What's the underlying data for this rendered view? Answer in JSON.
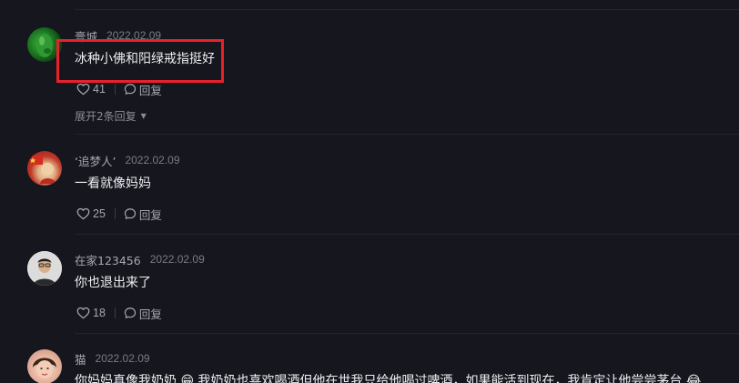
{
  "colors": {
    "background": "#15161e",
    "highlight": "#e8212b",
    "text_primary": "#eeeef0",
    "text_secondary": "#a8a9af"
  },
  "comments": [
    {
      "username": "膏城",
      "date": "2022.02.09",
      "text": "冰种小佛和阳绿戒指挺好",
      "likes": "41",
      "reply_label": "回复",
      "expand_label": "展开2条回复",
      "highlighted": true
    },
    {
      "username": "‘追梦人’",
      "date": "2022.02.09",
      "text": "一看就像妈妈",
      "likes": "25",
      "reply_label": "回复"
    },
    {
      "username": "在家123456",
      "date": "2022.02.09",
      "text": "你也退出来了",
      "likes": "18",
      "reply_label": "回复"
    },
    {
      "username": "猫",
      "date": "2022.02.09",
      "text": "你妈妈真像我奶奶 😁 我奶奶也喜欢喝酒但他在世我只给他喝过啤酒，如果能活到现在，我肯定让他尝尝茅台 😂"
    }
  ]
}
